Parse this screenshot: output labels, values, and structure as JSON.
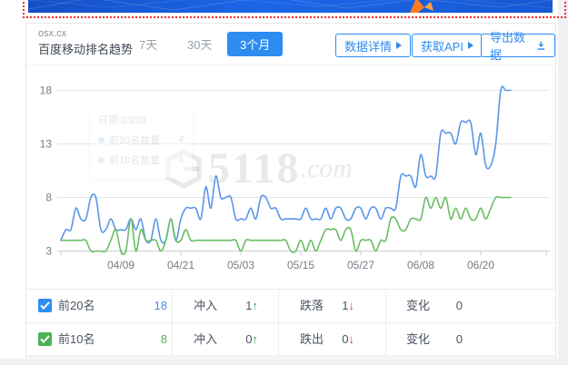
{
  "banner": {
    "bg_color": "#1658d2",
    "accent_color": "#ff7d1f"
  },
  "header": {
    "domain": "osx.cx",
    "title": "百度移动排名趋势",
    "tabs": [
      {
        "label": "7天",
        "active": false
      },
      {
        "label": "30天",
        "active": false
      },
      {
        "label": "3个月",
        "active": true
      }
    ],
    "buttons": [
      {
        "label": "数据详情",
        "icon": "caret-right"
      },
      {
        "label": "获取API",
        "icon": "caret-right"
      },
      {
        "label": "导出数据",
        "icon": "download"
      }
    ]
  },
  "chart_data": {
    "type": "line",
    "smooth": true,
    "grid": true,
    "legend_position": "none",
    "x_start_date": "03/28",
    "x_step_days": 1,
    "x_tick_labels": [
      "04/09",
      "04/21",
      "05/03",
      "05/15",
      "05/27",
      "06/08",
      "06/20"
    ],
    "y_ticks": [
      3,
      8,
      13,
      18
    ],
    "ylim": [
      3,
      18
    ],
    "series": [
      {
        "name": "前20名",
        "color": "#5b96e6",
        "values": [
          4,
          5,
          5,
          7,
          6,
          6,
          8,
          8,
          5,
          5,
          6,
          5,
          5,
          5,
          6,
          5,
          6,
          4,
          4,
          6,
          4,
          4,
          6,
          4,
          6,
          7,
          7,
          7,
          6,
          9,
          7,
          10,
          8,
          8,
          8,
          6,
          6,
          6,
          7,
          6,
          8,
          8,
          7,
          7,
          6,
          6,
          6,
          6,
          6,
          7,
          6,
          6,
          6,
          7,
          6,
          7,
          7,
          6,
          6,
          7,
          7,
          6,
          7,
          7,
          6,
          7,
          7,
          7,
          10,
          10,
          10,
          9,
          12,
          10,
          10,
          10,
          14,
          14,
          14,
          13,
          15,
          15,
          15,
          12,
          14,
          11,
          11,
          13,
          18,
          18,
          18
        ]
      },
      {
        "name": "前10名",
        "color": "#68bd63",
        "values": [
          4,
          4,
          4,
          4,
          4,
          4,
          3,
          3,
          3,
          3,
          4,
          5,
          3,
          3,
          6,
          3,
          5,
          4,
          4,
          4,
          3,
          4,
          6,
          4,
          4,
          5,
          4,
          4,
          4,
          4,
          4,
          4,
          4,
          4,
          4,
          4,
          3,
          4,
          4,
          4,
          4,
          4,
          4,
          4,
          4,
          4,
          3,
          3,
          4,
          3,
          4,
          3,
          4,
          5,
          5,
          5,
          4,
          5,
          5,
          3,
          4,
          4,
          4,
          3,
          4,
          4,
          6,
          6,
          5,
          5,
          6,
          6,
          6,
          8,
          7,
          8,
          7,
          8,
          6,
          7,
          6,
          7,
          6,
          6,
          7,
          6,
          7,
          8,
          8,
          8,
          8
        ]
      }
    ]
  },
  "tooltip_ghost": {
    "date": "日期:03/28",
    "rows": [
      {
        "label": "前20名数量",
        "value": "4"
      },
      {
        "label": "前10名数量",
        "value": "4"
      }
    ]
  },
  "watermark": {
    "number": "5118",
    "suffix": ".com"
  },
  "summary_table": {
    "rows": [
      {
        "name": "前20名",
        "total": "18",
        "checkbox_color": "#2d8cf0",
        "in_label": "冲入",
        "in_value": "1",
        "in_arrow": "↑",
        "out_label": "跌落",
        "out_value": "1",
        "out_arrow": "↓",
        "change_label": "变化",
        "change_value": "0"
      },
      {
        "name": "前10名",
        "total": "8",
        "checkbox_color": "#4cb153",
        "in_label": "冲入",
        "in_value": "0",
        "in_arrow": "↑",
        "out_label": "跌出",
        "out_value": "0",
        "out_arrow": "↓",
        "change_label": "变化",
        "change_value": "0"
      }
    ]
  },
  "colors": {
    "accent_blue": "#2d8cf0",
    "line_blue": "#5b96e6",
    "line_green": "#68bd63",
    "up_green": "#1fab4f",
    "down_red": "#e23e3a"
  }
}
